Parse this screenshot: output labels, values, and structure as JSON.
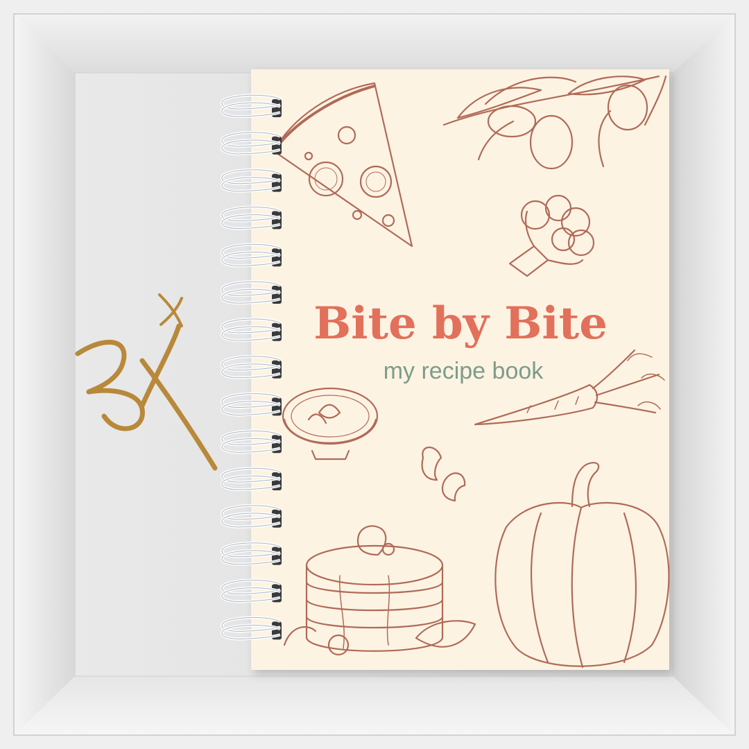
{
  "cover": {
    "title": "Bite by Bite",
    "subtitle": "my recipe book"
  },
  "logo_signature": "Bx",
  "colors": {
    "cover_background": "#fdf3e3",
    "title_color": "#e2705a",
    "subtitle_color": "#7d9c8a",
    "sketch_color": "#b06a57",
    "frame_light": "#f4f4f4",
    "frame_dark": "#c9c9c9",
    "signature_gold": "#b8893a",
    "spiral_metal": "#ffffff"
  },
  "illustrations": [
    "pizza-slice-icon",
    "olive-branch-icon",
    "broccoli-icon",
    "carrot-icon",
    "soup-bowl-icon",
    "cashew-nuts-icon",
    "pancake-stack-icon",
    "bell-pepper-icon"
  ]
}
